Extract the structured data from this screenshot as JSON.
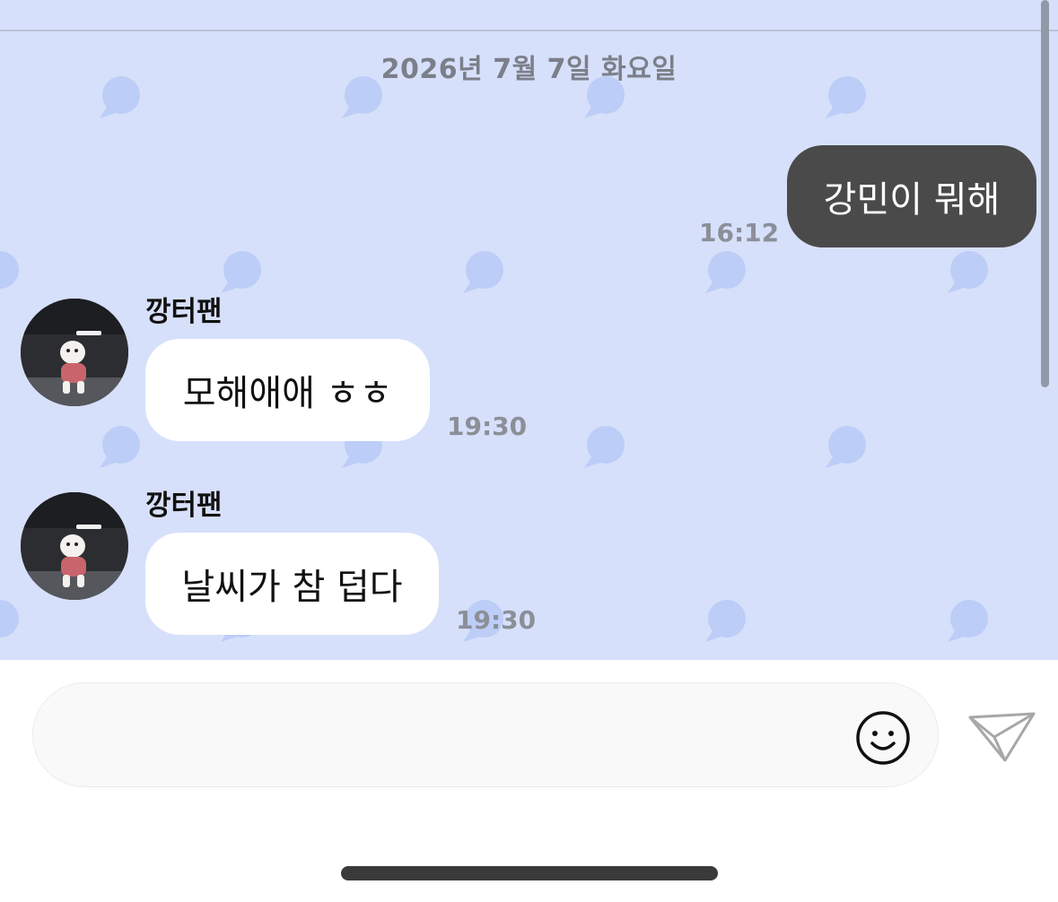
{
  "date_separator": "2026년 7월 7일 화요일",
  "messages": [
    {
      "direction": "sent",
      "text": "강민이 뭐해",
      "time": "16:12"
    },
    {
      "direction": "received",
      "sender": "깡터팬",
      "text": "모해애애 ㅎㅎ",
      "time": "19:30"
    },
    {
      "direction": "received",
      "sender": "깡터팬",
      "text": "날씨가 참 덥다",
      "time": "19:30"
    }
  ],
  "composer": {
    "placeholder": "",
    "value": ""
  },
  "icons": {
    "emoji": "smiley-face-icon",
    "send": "paper-plane-icon"
  },
  "colors": {
    "chat_background": "#d7e0fa",
    "pattern_bubble": "#bccdf7",
    "sent_bubble": "#4a4a4a",
    "received_bubble": "#ffffff"
  }
}
